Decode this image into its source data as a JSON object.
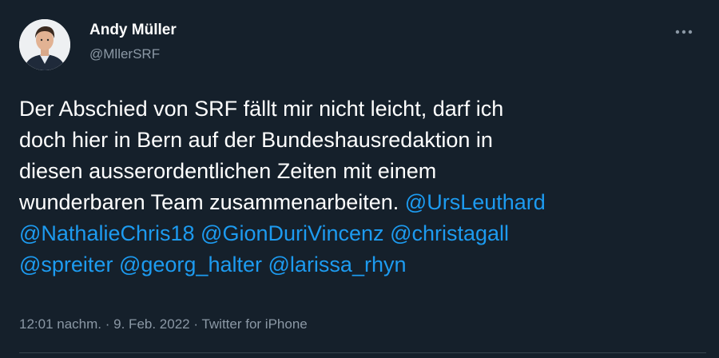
{
  "author": {
    "name": "Andy Müller",
    "handle": "@MllerSRF"
  },
  "tweet": {
    "line1": "Der Abschied von SRF fällt mir nicht leicht, darf ich",
    "line2": "doch hier in Bern auf der Bundeshausredaktion in",
    "line3": "diesen ausserordentlichen Zeiten mit einem",
    "line4": "wunderbaren Team zusammenarbeiten.",
    "mentions": [
      "@UrsLeuthard",
      "@NathalieChris18",
      "@GionDuriVincenz",
      "@christagall",
      "@spreiter",
      "@georg_halter",
      "@larissa_rhyn"
    ]
  },
  "meta": {
    "time": "12:01 nachm.",
    "separator": "·",
    "date": "9. Feb. 2022",
    "source": "Twitter for iPhone"
  },
  "icons": {
    "more": "more-horizontal-icon",
    "avatar": "profile-photo"
  },
  "colors": {
    "background": "#15202b",
    "text": "#ffffff",
    "secondary": "#8b98a5",
    "mention": "#1d9bf0"
  }
}
